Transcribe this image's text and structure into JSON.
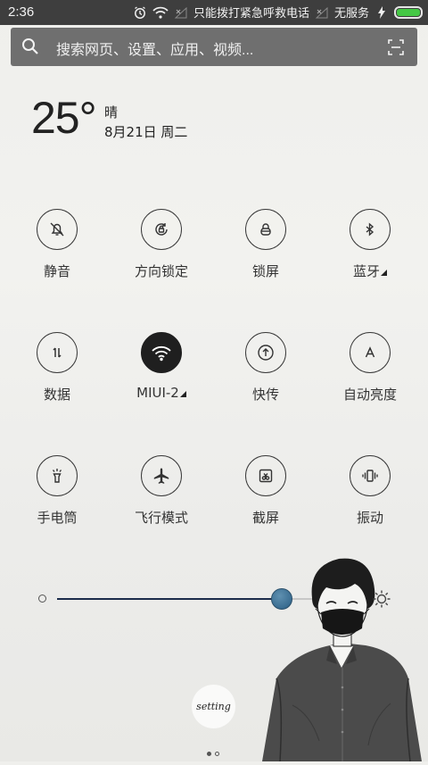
{
  "status_bar": {
    "time": "2:36",
    "call_notice": "只能拨打紧急呼救电话",
    "service_text": "无服务",
    "battery_level": 1.0
  },
  "search": {
    "placeholder": "搜索网页、设置、应用、视频..."
  },
  "weather": {
    "temperature": "25°",
    "condition": "晴",
    "date": "8月21日 周二"
  },
  "toggles": [
    {
      "label": "静音",
      "icon": "bell-off-icon"
    },
    {
      "label": "方向锁定",
      "icon": "rotation-lock-icon"
    },
    {
      "label": "锁屏",
      "icon": "lock-icon"
    },
    {
      "label": "蓝牙",
      "icon": "bluetooth-icon",
      "has_corner": true
    },
    {
      "label": "数据",
      "icon": "data-arrows-icon"
    },
    {
      "label": "MIUI-2",
      "icon": "wifi-icon",
      "active": true,
      "has_corner": true
    },
    {
      "label": "快传",
      "icon": "share-up-icon"
    },
    {
      "label": "自动亮度",
      "icon": "auto-brightness-icon"
    },
    {
      "label": "手电筒",
      "icon": "flashlight-icon"
    },
    {
      "label": "飞行模式",
      "icon": "airplane-icon"
    },
    {
      "label": "截屏",
      "icon": "screenshot-icon"
    },
    {
      "label": "振动",
      "icon": "vibrate-icon"
    }
  ],
  "brightness": {
    "level": 0.73
  },
  "decoration": {
    "badge_text": "setting"
  },
  "pager": {
    "pages": 2,
    "current": 1
  },
  "colors": {
    "status_bar_bg": "#3e3e3e",
    "search_bg": "#6f6f6f",
    "battery": "#45c845",
    "active_toggle": "#1f1f1f",
    "slider_thumb": "#2a5e84"
  }
}
